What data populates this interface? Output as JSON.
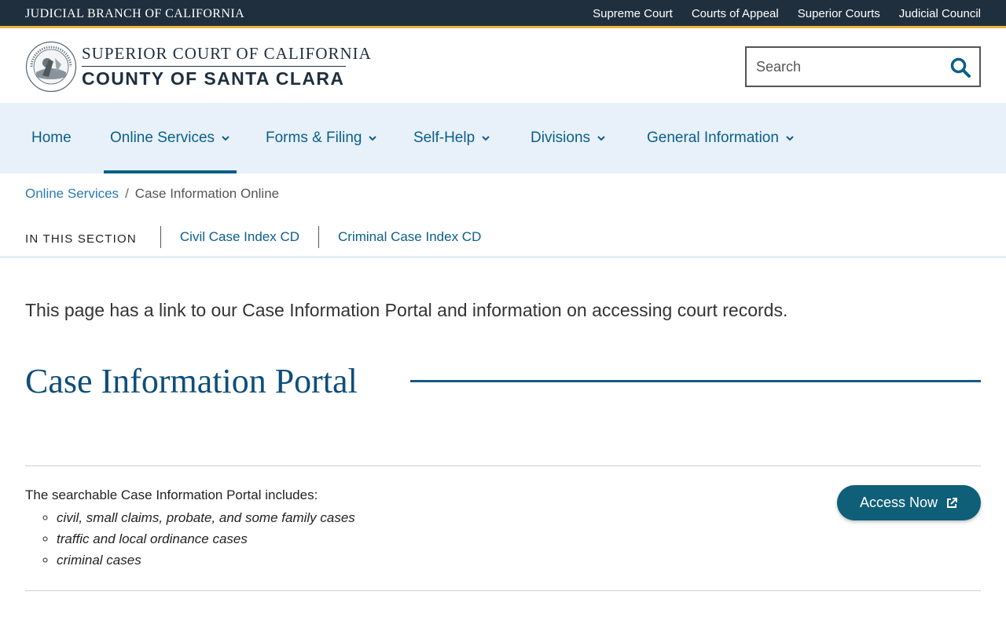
{
  "topbar": {
    "brand": "JUDICIAL BRANCH OF CALIFORNIA",
    "links": [
      "Supreme Court",
      "Courts of Appeal",
      "Superior Courts",
      "Judicial Council"
    ]
  },
  "header": {
    "line1": "SUPERIOR COURT OF CALIFORNIA",
    "line2": "COUNTY OF SANTA CLARA",
    "search_placeholder": "Search",
    "seal_text": "JUDICIAL BRANCH OF CALIFORNIA"
  },
  "nav": {
    "items": [
      {
        "label": "Home",
        "has_menu": false
      },
      {
        "label": "Online Services",
        "has_menu": true,
        "active": true
      },
      {
        "label": "Forms & Filing",
        "has_menu": true
      },
      {
        "label": "Self-Help",
        "has_menu": true
      },
      {
        "label": "Divisions",
        "has_menu": true
      },
      {
        "label": "General Information",
        "has_menu": true
      }
    ]
  },
  "breadcrumb": {
    "parent": "Online Services",
    "separator": "/",
    "current": "Case Information Online"
  },
  "section_nav": {
    "label": "IN THIS SECTION",
    "links": [
      "Civil Case Index CD",
      "Criminal Case Index CD"
    ]
  },
  "content": {
    "intro": "This page has a link to our Case Information Portal and information on accessing court records.",
    "heading": "Case Information Portal",
    "portal_text": "The searchable Case Information Portal includes:",
    "portal_items": [
      " civil, small claims, probate, and some family cases",
      "traffic and local ordinance cases",
      "criminal cases"
    ],
    "access_button": "Access Now"
  },
  "colors": {
    "topbar_bg": "#1f2f3e",
    "accent_gold": "#f2b33d",
    "nav_bg": "#e8f1f9",
    "link_blue": "#0b5f8a",
    "button_teal": "#0f5f78"
  }
}
